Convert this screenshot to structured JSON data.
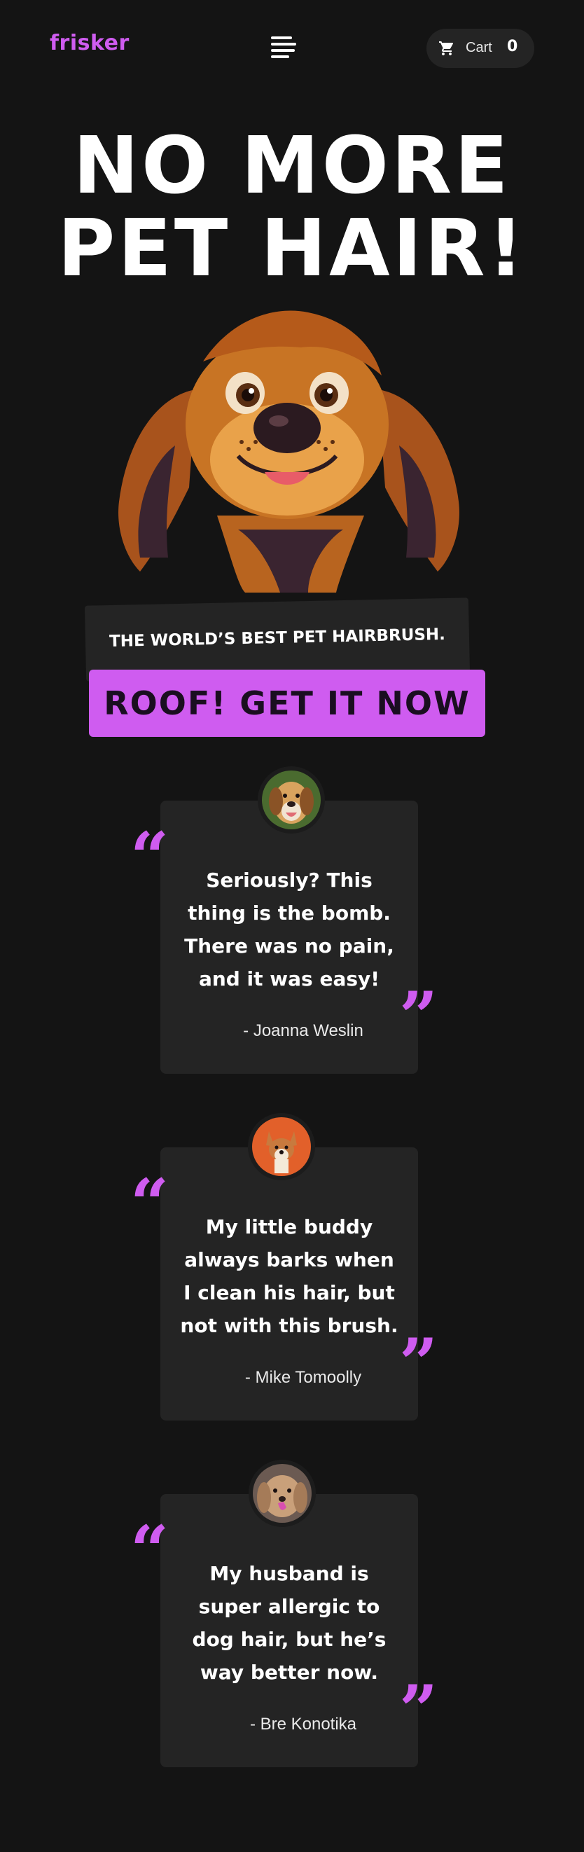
{
  "header": {
    "logo": "frisker",
    "cart_label": "Cart",
    "cart_count": "0",
    "menu_icon": "hamburger-menu-icon",
    "cart_icon": "shopping-cart-icon"
  },
  "hero": {
    "title_line1": "NO MORE",
    "title_line2": "PET HAIR!",
    "image": "cartoon-dog-illustration",
    "tagline": "THE WORLD’S BEST PET HAIRBRUSH.",
    "cta_label": "ROOF! GET IT NOW"
  },
  "testimonials": [
    {
      "quote": "Seriously? This thing is the bomb. There was no pain, and it was easy!",
      "author": "- Joanna Weslin",
      "avatar": "beagle-avatar"
    },
    {
      "quote": "My little buddy always barks when I clean his hair, but not with this brush.",
      "author": "- Mike Tomoolly",
      "avatar": "corgi-avatar"
    },
    {
      "quote": "My husband is super allergic to dog hair, but he’s way better now.",
      "author": "- Bre Konotika",
      "avatar": "golden-dog-avatar"
    }
  ],
  "colors": {
    "background": "#141414",
    "accent": "#cf5cf0",
    "card": "#242424",
    "text": "#ffffff"
  }
}
